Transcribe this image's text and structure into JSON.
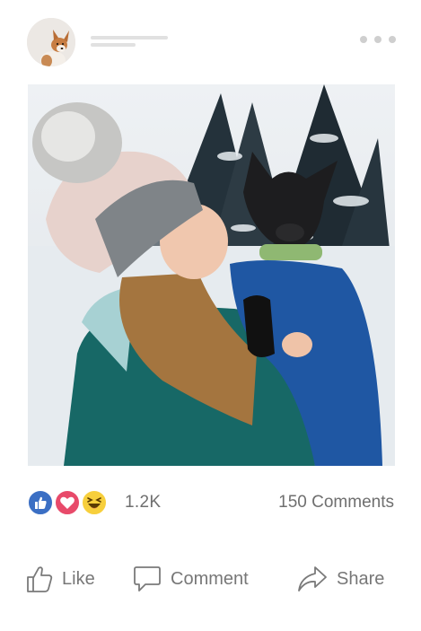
{
  "post": {
    "header": {
      "avatar_icon": "dog-avatar-icon",
      "more_icon": "more-dots-icon"
    },
    "photo": {
      "subject_icon": "woman-holding-dog-photo"
    },
    "reactions": {
      "icons": [
        "like-reaction-icon",
        "love-reaction-icon",
        "haha-reaction-icon"
      ],
      "colors": {
        "like": "#3b6fc4",
        "love": "#e84a6a",
        "haha": "#f7cf3c"
      },
      "count": "1.2K"
    },
    "comments_count": "150 Comments",
    "actions": {
      "like_label": "Like",
      "comment_label": "Comment",
      "share_label": "Share"
    }
  }
}
